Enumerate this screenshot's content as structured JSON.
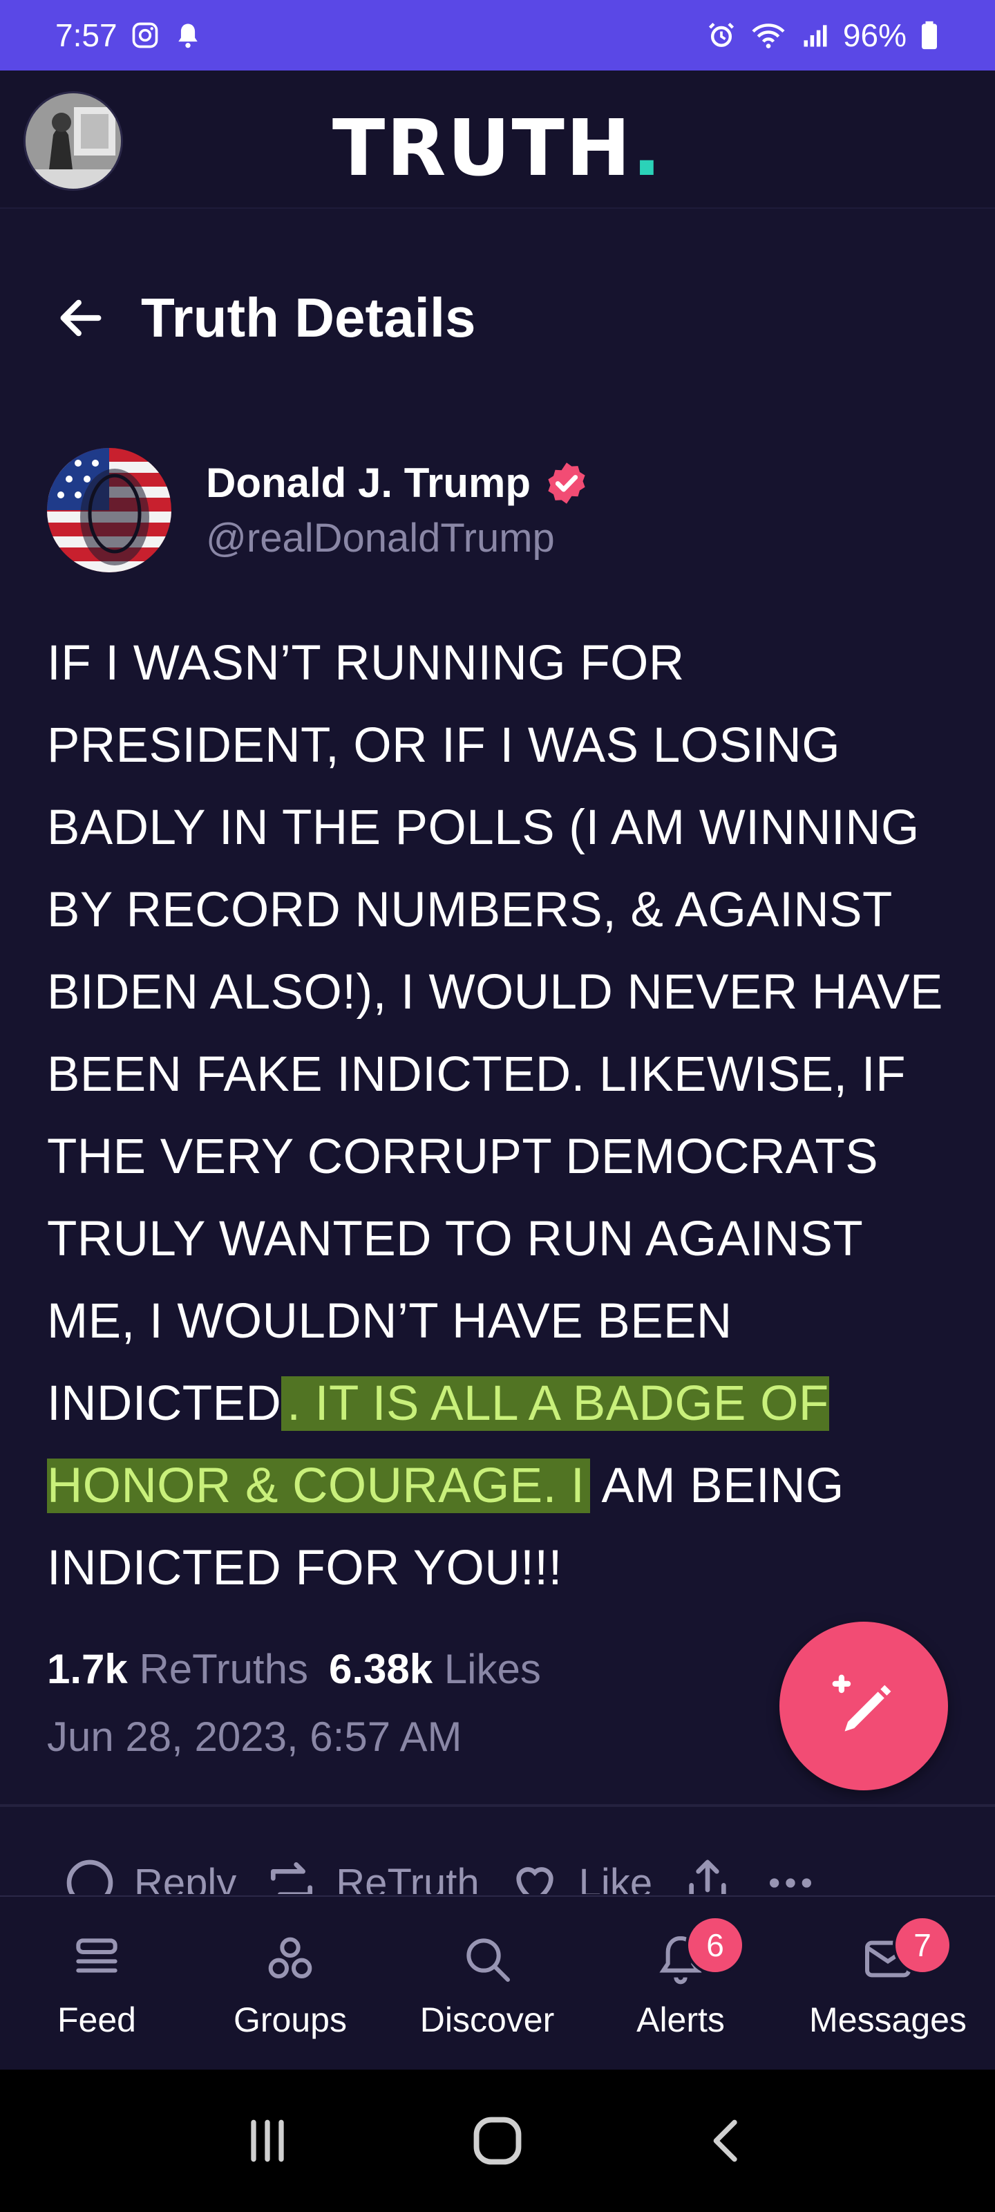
{
  "status_bar": {
    "time": "7:57",
    "battery_percent": "96%",
    "icons": [
      "instagram-icon",
      "notification-bell-icon",
      "alarm-icon",
      "wifi-icon",
      "signal-icon",
      "battery-icon"
    ]
  },
  "header": {
    "logo_text": "TRUTH",
    "logo_dot": "."
  },
  "page": {
    "title": "Truth Details"
  },
  "post": {
    "author_name": "Donald J. Trump",
    "author_handle": "@realDonaldTrump",
    "verified": true,
    "text_before_highlight": "IF I WASN’T RUNNING FOR PRESIDENT, OR IF I WAS LOSING BADLY IN THE POLLS (I AM WINNING BY RECORD NUMBERS, & AGAINST BIDEN ALSO!), I WOULD NEVER HAVE BEEN FAKE INDICTED. LIKEWISE, IF THE VERY CORRUPT DEMOCRATS TRULY WANTED TO RUN AGAINST ME, I WOULDN’T HAVE BEEN INDICTED",
    "text_highlighted": ". IT IS ALL A BADGE OF HONOR & COURAGE. I",
    "text_after_highlight": " AM BEING INDICTED FOR YOU!!!",
    "retruths_count": "1.7k",
    "retruths_label": "ReTruths",
    "likes_count": "6.38k",
    "likes_label": "Likes",
    "date": "Jun 28, 2023, 6:57 AM"
  },
  "actions": {
    "reply": "Reply",
    "retruth": "ReTruth",
    "like": "Like"
  },
  "bottom_nav": {
    "feed": "Feed",
    "groups": "Groups",
    "discover": "Discover",
    "alerts": "Alerts",
    "alerts_badge": "6",
    "messages": "Messages",
    "messages_badge": "7"
  },
  "colors": {
    "background": "#16132e",
    "status_bar": "#5a48e6",
    "accent_pink": "#f24c74",
    "logo_dot": "#2bd2b8",
    "highlight": "#659620"
  }
}
